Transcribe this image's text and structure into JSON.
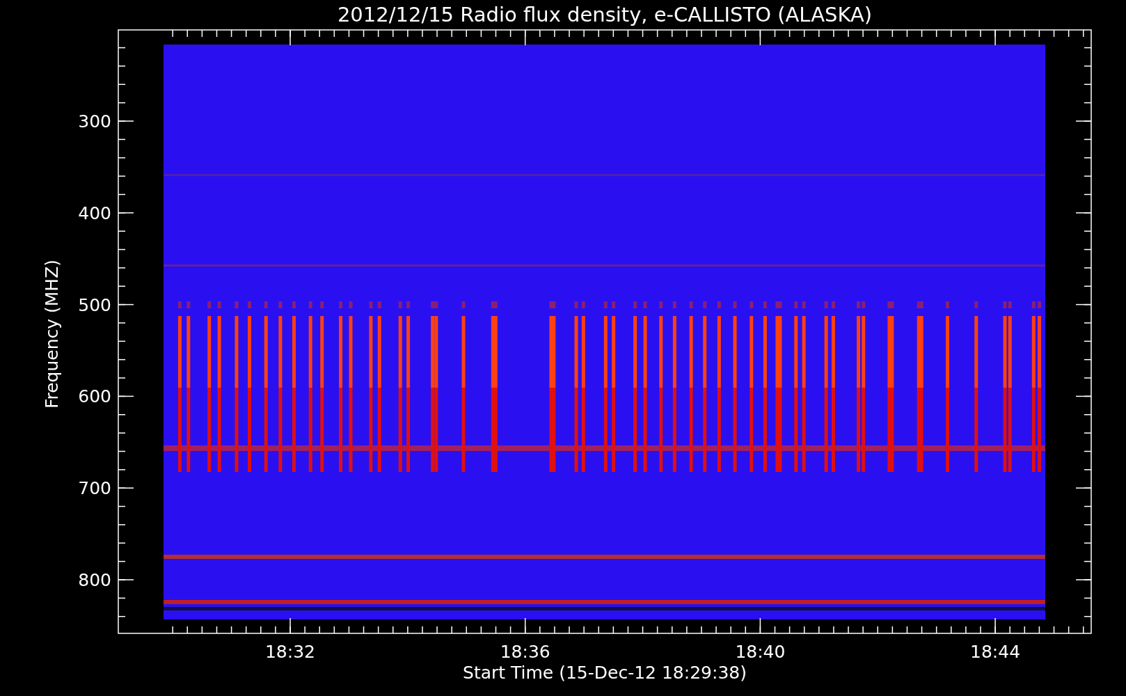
{
  "title": "2012/12/15  Radio flux density, e-CALLISTO (ALASKA)",
  "x_axis": {
    "label": "Start Time (15-Dec-12 18:29:38)",
    "ticks": [
      "18:32",
      "18:36",
      "18:40",
      "18:44"
    ]
  },
  "y_axis": {
    "label": "Frequency (MHZ)",
    "ticks": [
      "300",
      "400",
      "500",
      "600",
      "700",
      "800"
    ]
  }
}
